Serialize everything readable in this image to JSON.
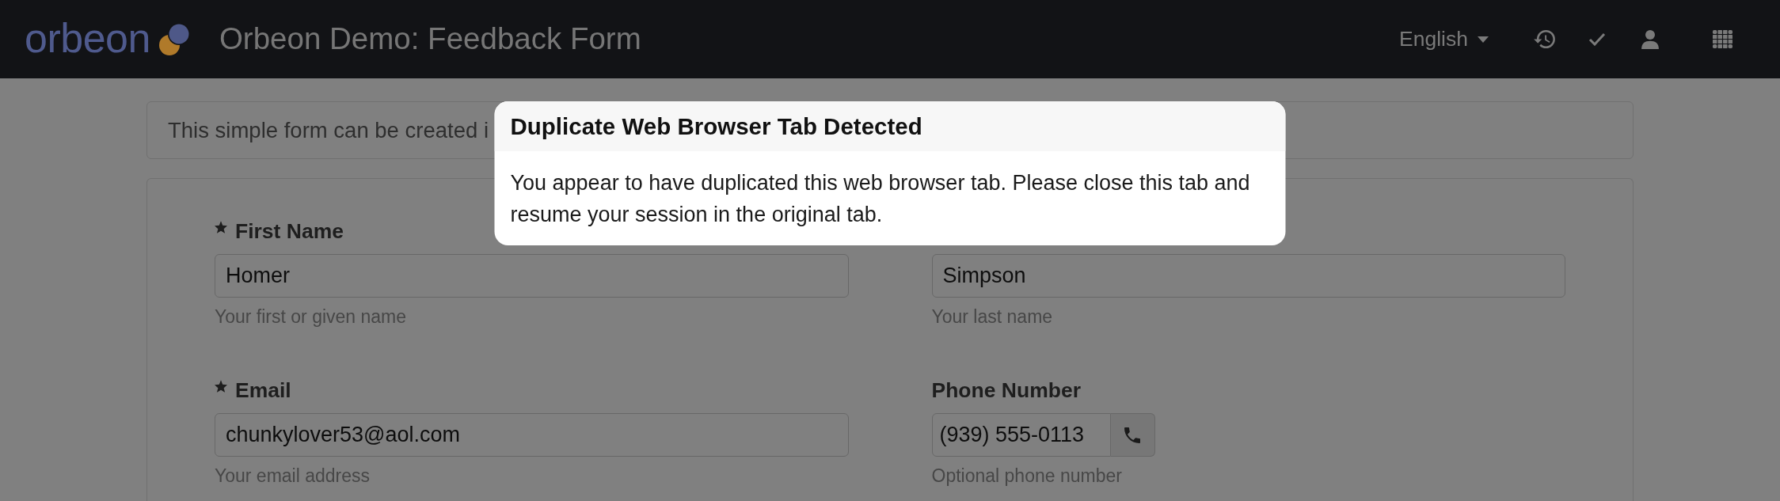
{
  "navbar": {
    "logo": "orbeon",
    "title": "Orbeon Demo: Feedback Form",
    "language": "English"
  },
  "intro": {
    "text": "This simple form can be created i"
  },
  "form": {
    "fields": [
      {
        "kind": "text",
        "label": "First Name",
        "required": true,
        "value": "Homer",
        "help": "Your first or given name"
      },
      {
        "kind": "text",
        "value": "Simpson",
        "help": "Your last name"
      },
      {
        "kind": "text",
        "label": "Email",
        "required": true,
        "value": "chunkylover53@aol.com",
        "help": "Your email address"
      },
      {
        "kind": "phone",
        "label": "Phone Number",
        "required": false,
        "value": "(939) 555-0113",
        "help": "Optional phone number"
      }
    ]
  },
  "dialog": {
    "title": "Duplicate Web Browser Tab Detected",
    "message": "You appear to have duplicated this web browser tab. Please close this tab and resume your session in the original tab."
  }
}
